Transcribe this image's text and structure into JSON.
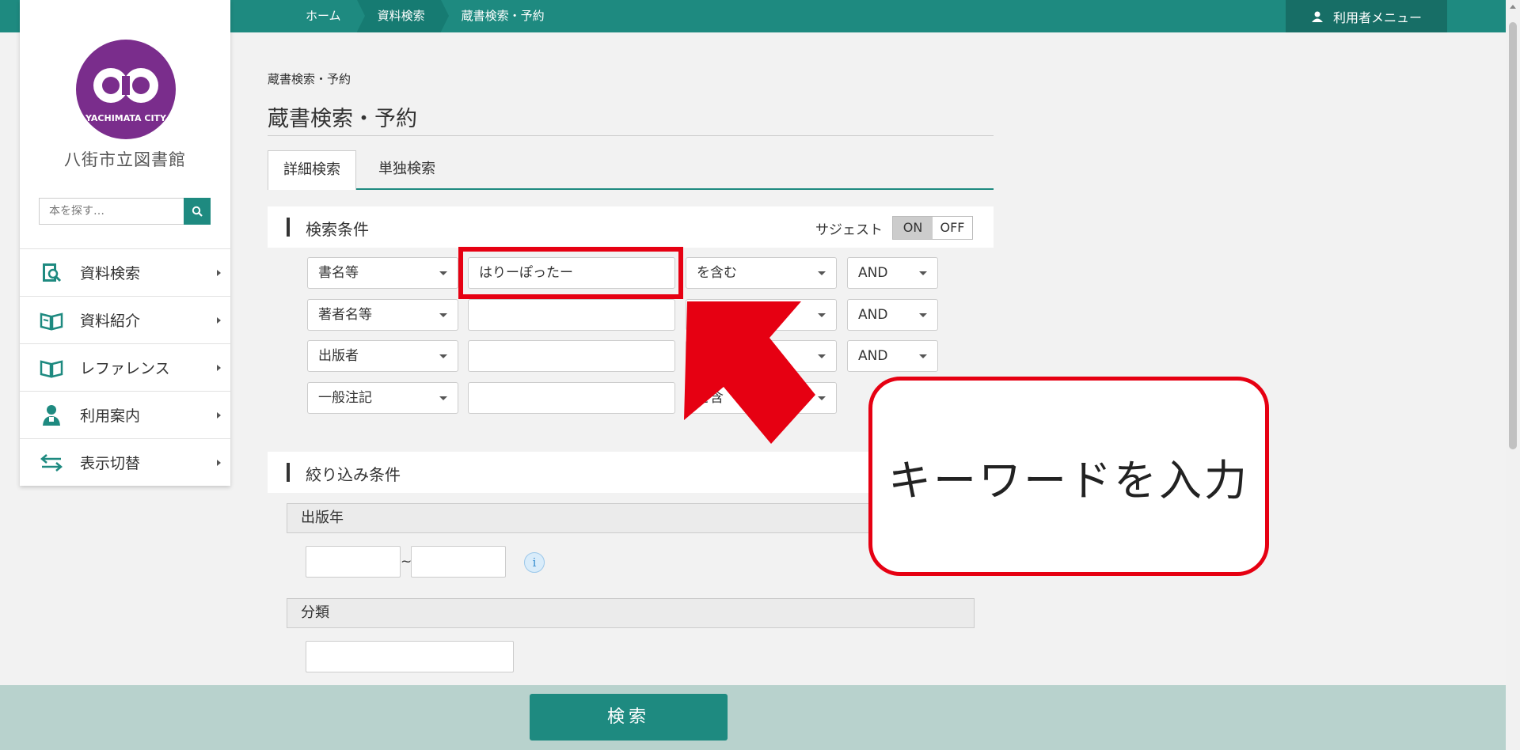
{
  "header": {
    "breadcrumbs": [
      "ホーム",
      "資料検索",
      "蔵書検索・予約"
    ],
    "user_menu": "利用者メニュー"
  },
  "sidebar": {
    "library_name": "八街市立図書館",
    "logo_text": "YACHIMATA CITY",
    "search_placeholder": "本を探す…",
    "items": [
      {
        "label": "資料検索",
        "icon": "book-search-icon"
      },
      {
        "label": "資料紹介",
        "icon": "open-book-icon"
      },
      {
        "label": "レファレンス",
        "icon": "open-book-icon"
      },
      {
        "label": "利用案内",
        "icon": "person-icon"
      },
      {
        "label": "表示切替",
        "icon": "swap-arrows-icon"
      }
    ]
  },
  "main": {
    "breadcrumb": "蔵書検索・予約",
    "title": "蔵書検索・予約",
    "tabs": [
      "詳細検索",
      "単独検索"
    ],
    "conditions": {
      "heading": "検索条件",
      "suggest_label": "サジェスト",
      "toggle_on": "ON",
      "toggle_off": "OFF",
      "rows": [
        {
          "field": "書名等",
          "value": "はりーぽったー",
          "match": "を含む",
          "logic": "AND"
        },
        {
          "field": "著者名等",
          "value": "",
          "match": "",
          "logic": "AND"
        },
        {
          "field": "出版者",
          "value": "",
          "match": "",
          "logic": "AND"
        },
        {
          "field": "一般注記",
          "value": "",
          "match": "を含"
        }
      ]
    },
    "filters": {
      "heading": "絞り込み条件",
      "pub_year_label": "出版年",
      "range_sep": "~",
      "info_icon": "i",
      "classification_label": "分類"
    },
    "search_button": "検索"
  },
  "annotation": {
    "callout_text": "キーワードを入力",
    "color": "#e60012"
  },
  "colors": {
    "brand": "#1e8a80",
    "bottom_bar": "#b8d2cd"
  }
}
